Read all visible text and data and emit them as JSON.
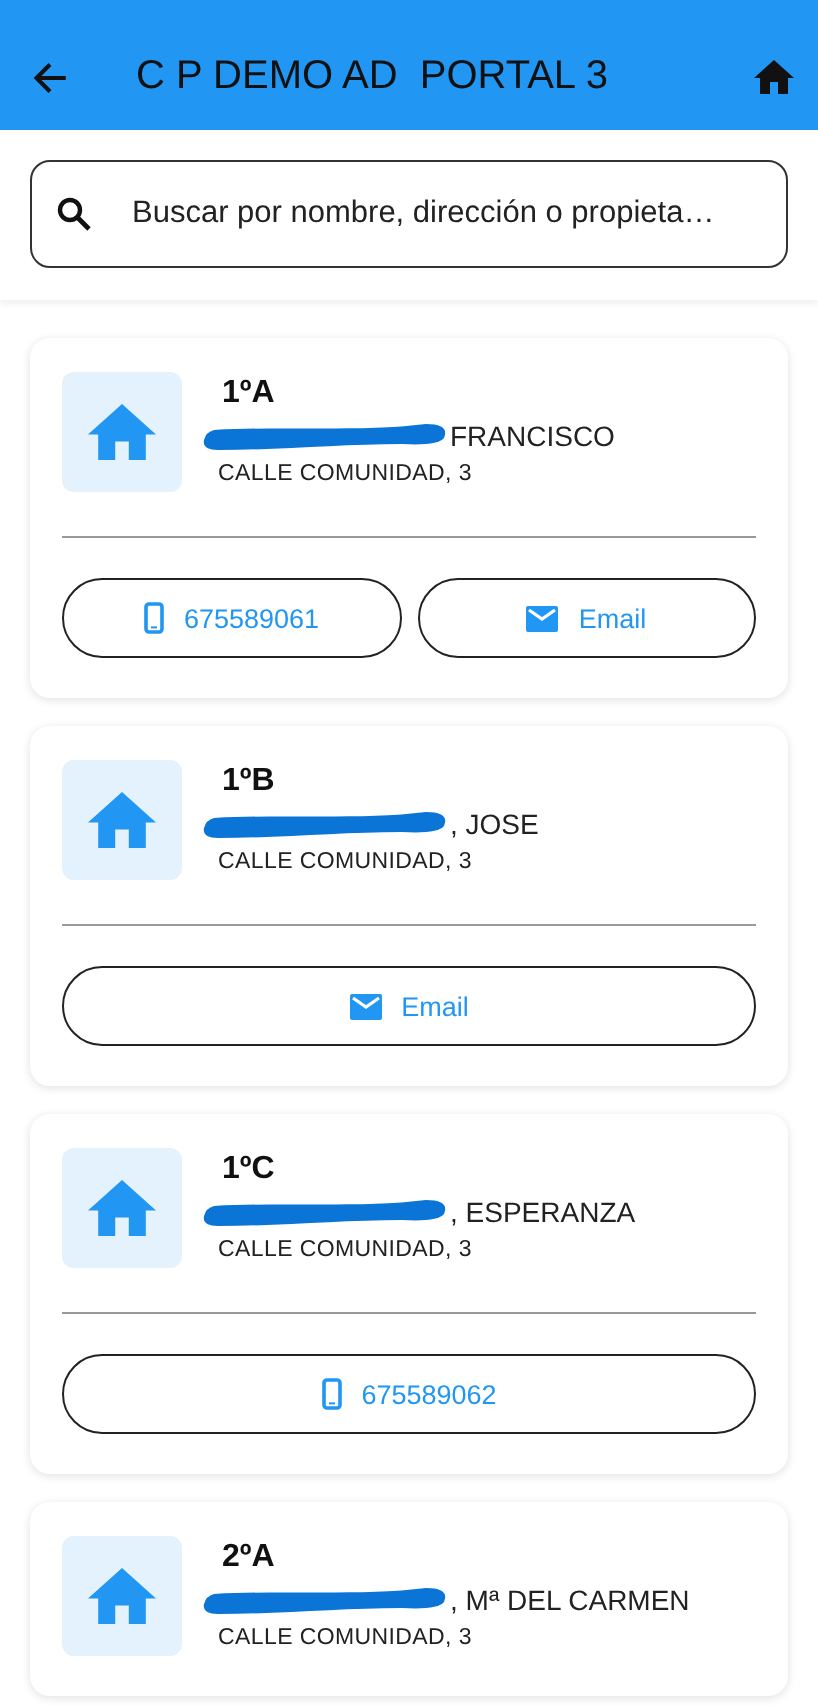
{
  "app_bar": {
    "title": "C P DEMO AD  PORTAL 3"
  },
  "search": {
    "placeholder": "Buscar por nombre, dirección o propieta…"
  },
  "units": [
    {
      "unit": "1ºA",
      "owner": "FRANCISCO",
      "redacted": true,
      "address": "CALLE COMUNIDAD, 3",
      "actions": [
        {
          "kind": "phone",
          "label": "675589061"
        },
        {
          "kind": "email",
          "label": "Email"
        }
      ]
    },
    {
      "unit": "1ºB",
      "owner": ", JOSE",
      "redacted": true,
      "address": "CALLE COMUNIDAD, 3",
      "actions": [
        {
          "kind": "email",
          "label": "Email"
        }
      ]
    },
    {
      "unit": "1ºC",
      "owner": ", ESPERANZA",
      "redacted": true,
      "address": "CALLE COMUNIDAD, 3",
      "actions": [
        {
          "kind": "phone",
          "label": "675589062"
        }
      ]
    },
    {
      "unit": "2ºA",
      "owner": ", Mª DEL CARMEN",
      "redacted": true,
      "address": "CALLE COMUNIDAD, 3"
    }
  ]
}
